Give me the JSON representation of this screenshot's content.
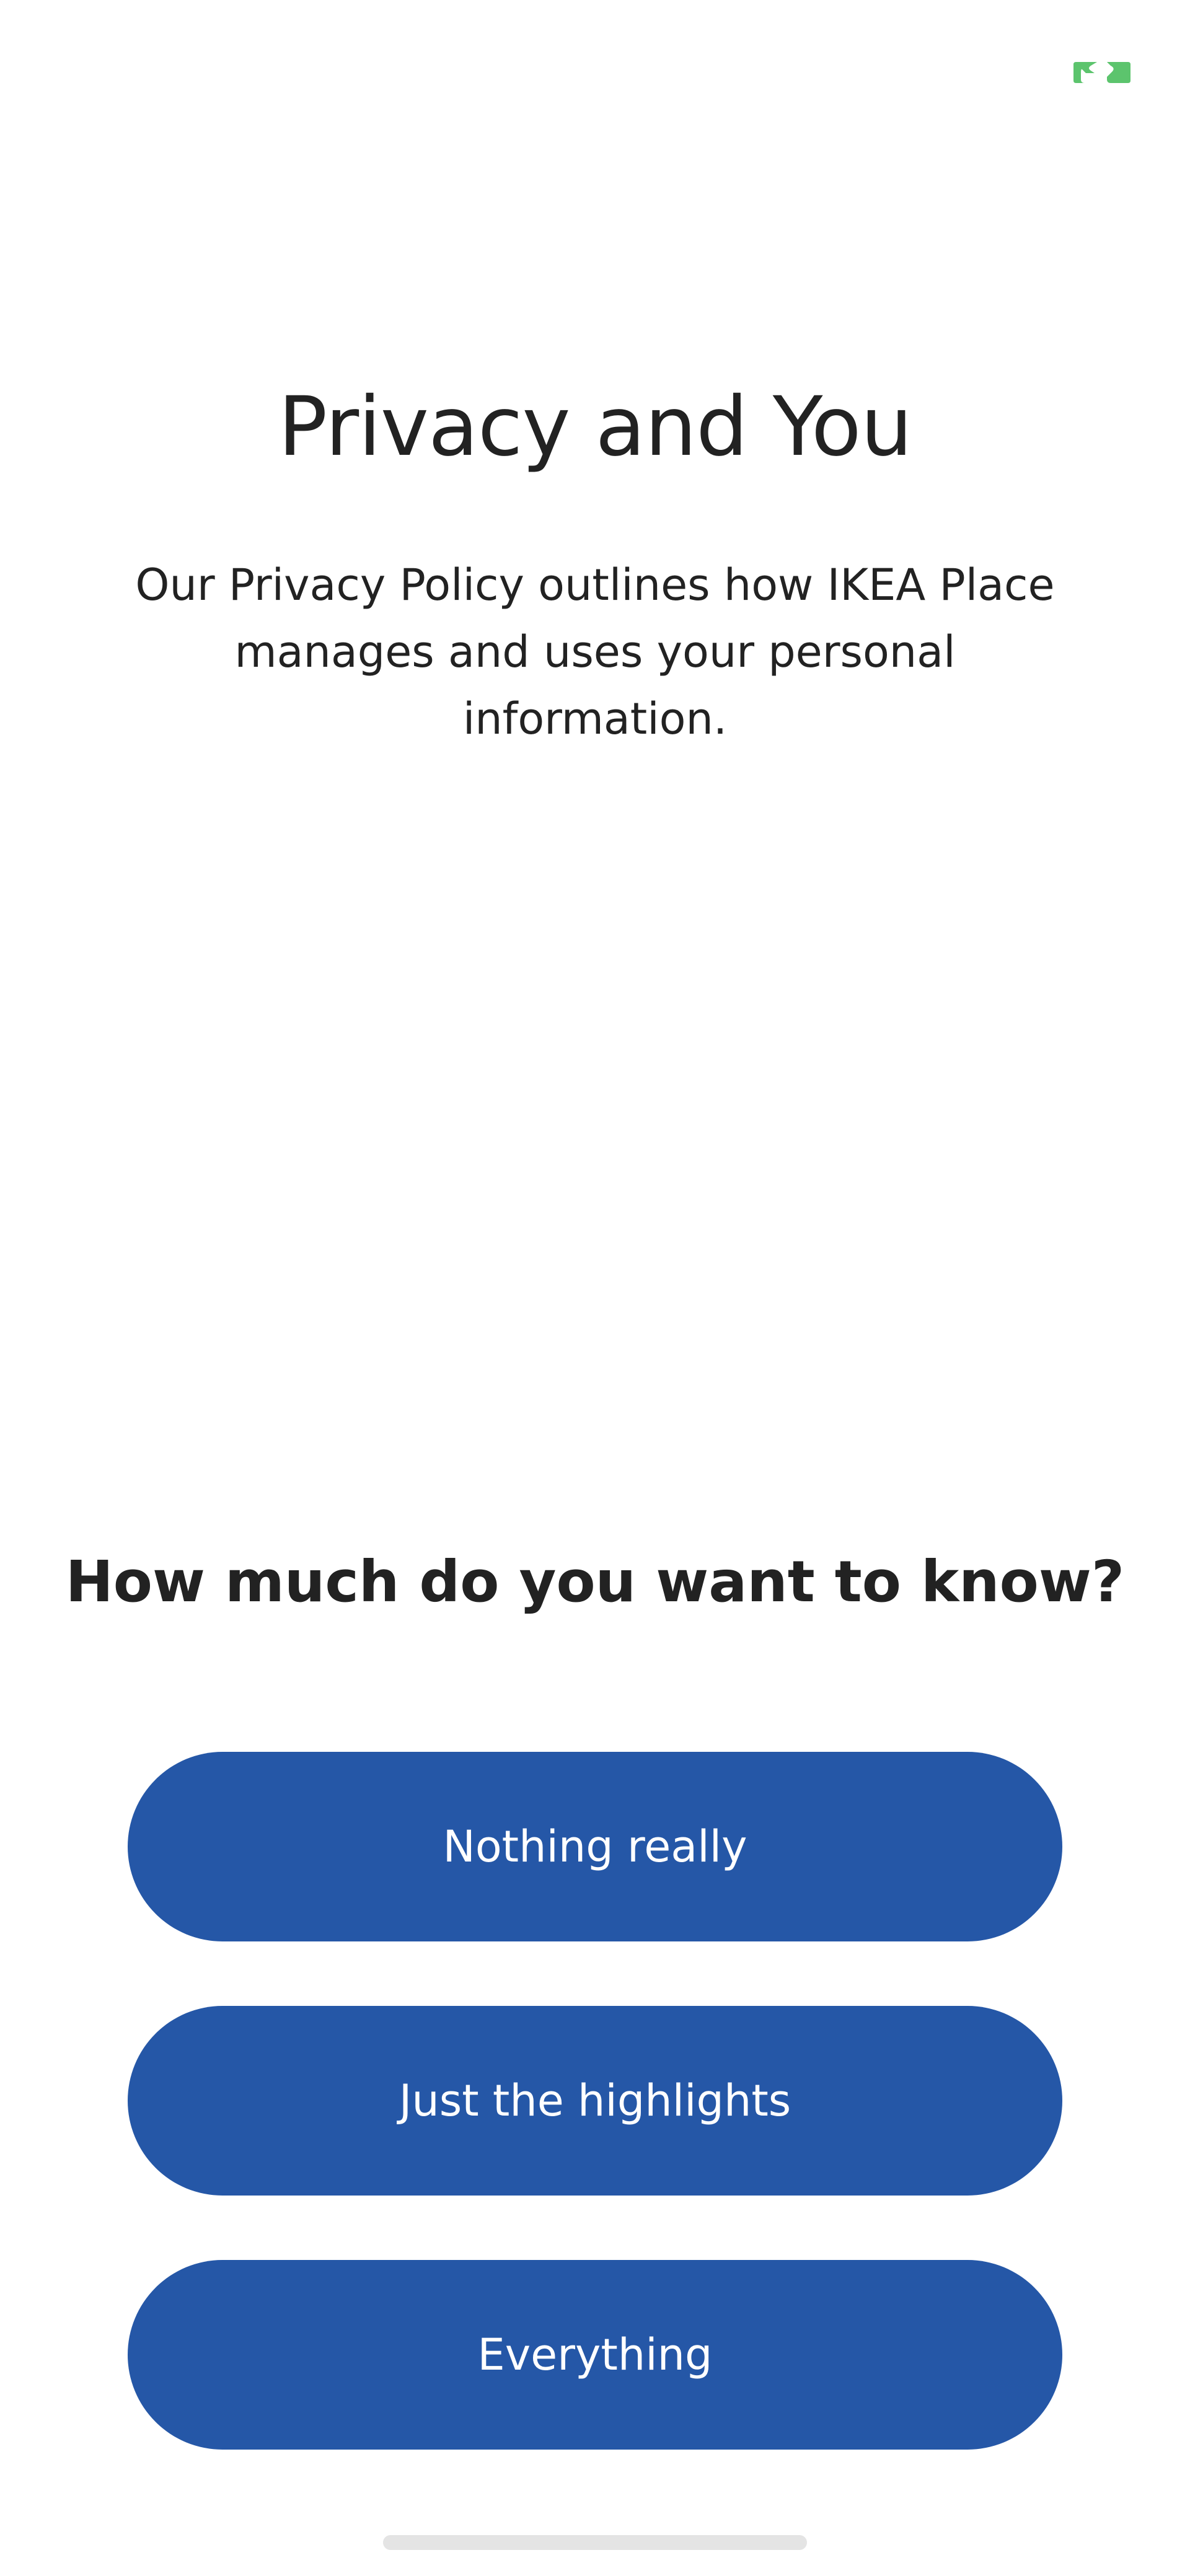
{
  "page": {
    "title": "Privacy and You",
    "subtitle": "Our Privacy Policy outlines how IKEA Place manages and uses your personal information.",
    "question": "How much do you want to know?"
  },
  "options": [
    {
      "label": "Nothing really"
    },
    {
      "label": "Just the highlights"
    },
    {
      "label": "Everything"
    }
  ],
  "colors": {
    "button_background": "#2557a7",
    "button_text": "#ffffff",
    "text": "#222222",
    "status_indicator": "#5cc46d",
    "home_indicator": "#e4e4e4"
  },
  "icons": {
    "status_indicator": "camera-in-use-icon"
  }
}
